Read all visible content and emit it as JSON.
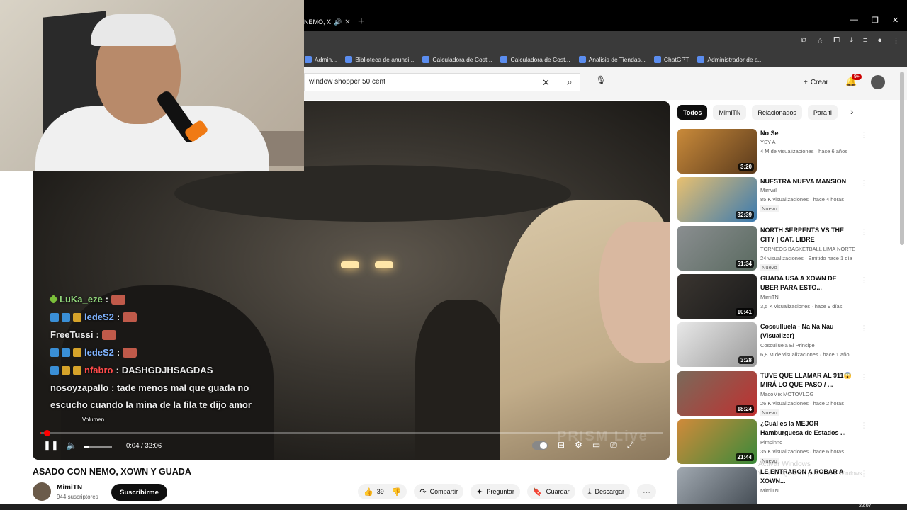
{
  "browser": {
    "tab_title": "NEMO, X",
    "bookmarks": [
      "Admin...",
      "Biblioteca de anunci...",
      "Calculadora de Cost...",
      "Calculadora de Cost...",
      "Analisis de Tiendas...",
      "ChatGPT",
      "Administrador de a..."
    ]
  },
  "header": {
    "search_value": "window shopper 50 cent",
    "create_label": "Crear",
    "notif_badge": "9+"
  },
  "player": {
    "chat": [
      {
        "user": "LuKa_eze",
        "message": "",
        "user_color": "green"
      },
      {
        "user": "ledeS2",
        "message": "",
        "user_color": "blue"
      },
      {
        "user": "FreeTussi",
        "message": "",
        "user_color": "plain"
      },
      {
        "user": "ledeS2",
        "message": "",
        "user_color": "blue"
      },
      {
        "user": "nfabro",
        "message": "DASHGDJHSAGDAS",
        "user_color": "red"
      }
    ],
    "chat_long": "nosoyzapallo : tade menos mal que guada no escucho cuando la mina de la fila te dijo amor",
    "watermark": "PRISM Live",
    "volume_label": "Volumen",
    "time_display": "0:04 / 32:06",
    "progress_fraction": 0.002,
    "volume_fraction": 0.2
  },
  "video": {
    "title": "ASADO CON NEMO, XOWN Y GUADA",
    "channel": "MimiTN",
    "subscribers": "944 suscriptores",
    "subscribe_label": "Suscribirme",
    "likes": "39",
    "share_label": "Compartir",
    "ask_label": "Preguntar",
    "save_label": "Guardar",
    "download_label": "Descargar"
  },
  "chips": [
    "Todos",
    "MimiTN",
    "Relacionados",
    "Para ti"
  ],
  "recommendations": [
    {
      "title": "No Se",
      "channel": "YSY A",
      "meta": "4 M de visualizaciones · hace 6 años",
      "new": "",
      "duration": "3:20",
      "colors": [
        "#c98a3a",
        "#5a3a1c"
      ]
    },
    {
      "title": "NUESTRA NUEVA MANSION",
      "channel": "Mimwil",
      "meta": "85 K visualizaciones · hace 4 horas",
      "new": "Nuevo",
      "duration": "32:39",
      "colors": [
        "#e8c070",
        "#3a7ab0"
      ]
    },
    {
      "title": "NORTH SERPENTS VS THE CITY | CAT. LIBRE",
      "channel": "TORNEOS BASKETBALL LIMA NORTE",
      "meta": "24 visualizaciones · Emitido hace 1 día",
      "new": "Nuevo",
      "duration": "51:34",
      "colors": [
        "#8a8e90",
        "#5a6a60"
      ]
    },
    {
      "title": "GUADA USA A XOWN DE UBER PARA ESTO...",
      "channel": "MimiTN",
      "meta": "3,5 K visualizaciones · hace 9 días",
      "new": "",
      "duration": "10:41",
      "colors": [
        "#3a3530",
        "#1a1a1a"
      ]
    },
    {
      "title": "Cosculluela - Na Na Nau (Visualizer)",
      "channel": "Cosculluela El Principe",
      "meta": "6,8 M de visualizaciones · hace 1 año",
      "new": "",
      "duration": "3:28",
      "colors": [
        "#e8e8e8",
        "#9a9a9a"
      ]
    },
    {
      "title": "TUVE QUE LLAMAR AL 911😱 MIRÁ LO QUE PASO / ...",
      "channel": "MacoMix MOTOVLOG",
      "meta": "26 K visualizaciones · hace 2 horas",
      "new": "Nuevo",
      "duration": "18:24",
      "colors": [
        "#7a6a5a",
        "#c03030"
      ]
    },
    {
      "title": "¿Cuál es la MEJOR Hamburguesa de Estados ...",
      "channel": "Pimpinno",
      "meta": "35 K visualizaciones · hace 6 horas",
      "new": "Nuevo",
      "duration": "21:44",
      "colors": [
        "#d08a3a",
        "#3a8a3a"
      ]
    },
    {
      "title": "LE ENTRARON A ROBAR A XOWN...",
      "channel": "MimiTN",
      "meta": "",
      "new": "",
      "duration": "",
      "colors": [
        "#a0a8b0",
        "#404850"
      ]
    }
  ],
  "taskbar": {
    "clock": "22:07"
  },
  "windows_watermark": {
    "line1": "Activar Windows",
    "line2": "Ve a Configuración para activar Windows."
  }
}
